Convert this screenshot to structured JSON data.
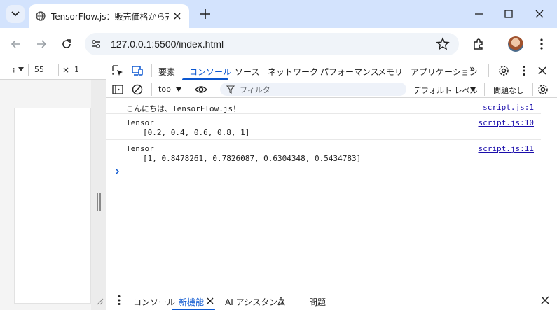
{
  "browser": {
    "tab_title": "TensorFlow.js：販売価格から売れ",
    "url": "127.0.0.1:5500/index.html"
  },
  "device_toolbar": {
    "dimension_label": "⁝",
    "width_value": "55",
    "times": "×",
    "height_value": "1"
  },
  "devtools": {
    "tabs": [
      "要素",
      "コンソール",
      "ソース",
      "ネットワーク",
      "パフォーマンス",
      "メモリ",
      "アプリケーション"
    ],
    "active_tab": "コンソール",
    "overflow": "»",
    "console_bar": {
      "context": "top",
      "filter_placeholder": "フィルタ",
      "levels": "デフォルト レベル",
      "issues": "問題なし"
    },
    "messages": [
      {
        "text": "こんにちは、TensorFlow.js！",
        "source": "script.js:1"
      },
      {
        "text": "Tensor",
        "detail": "[0.2, 0.4, 0.6, 0.8, 1]",
        "source": "script.js:10"
      },
      {
        "text": "Tensor",
        "detail": "[1, 0.8478261, 0.7826087, 0.6304348, 0.5434783]",
        "source": "script.js:11"
      }
    ],
    "drawer_tabs": [
      "コンソール",
      "新機能",
      "AI アシスタンス",
      "問題"
    ],
    "drawer_active": "新機能"
  },
  "colors": {
    "accent": "#0b57d0",
    "tabstrip": "#d3e3fd",
    "link": "#1a0dab"
  },
  "icons": [
    "tab-search-icon",
    "favicon-icon",
    "close-icon",
    "new-tab-icon",
    "minimize-icon",
    "maximize-icon",
    "back-icon",
    "forward-icon",
    "reload-icon",
    "site-info-icon",
    "bookmark-star-icon",
    "extensions-icon",
    "kebab-menu-icon",
    "inspect-icon",
    "device-toggle-icon",
    "settings-gear-icon",
    "sidebar-icon",
    "clear-icon",
    "eye-icon",
    "filter-icon",
    "chevron-right-icon",
    "flask-icon"
  ]
}
